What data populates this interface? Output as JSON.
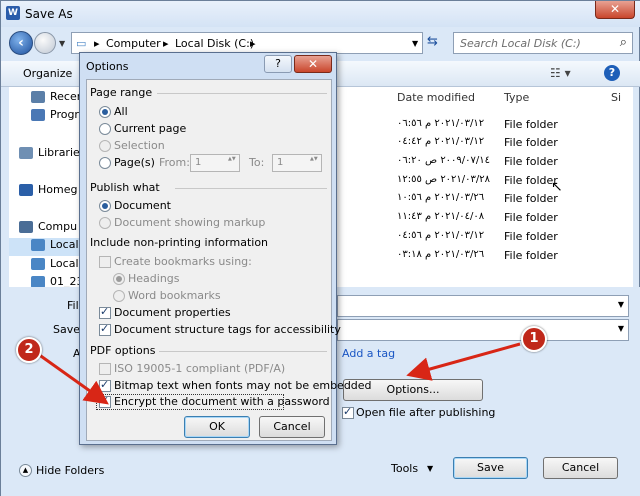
{
  "window": {
    "title": "Save As",
    "app_icon": "W",
    "close": "✕"
  },
  "nav": {
    "back_icon": "back-arrow-icon",
    "breadcrumb": [
      "Computer",
      "Local Disk (C:)"
    ],
    "sep": "▸",
    "search_placeholder": "Search Local Disk (C:)"
  },
  "toolbar": {
    "organize": "Organize",
    "help": "?"
  },
  "sidebar": {
    "items": [
      {
        "label": "Recen",
        "color": "#5b7fa8"
      },
      {
        "label": "Progr",
        "color": "#4a78b5"
      },
      {
        "label": "Librarie",
        "color": "#6f8fb3"
      },
      {
        "label": "Homeg",
        "color": "#2b5fa8"
      },
      {
        "label": "Compu",
        "color": "#4a6d96"
      },
      {
        "label": "Local",
        "color": "#4a86c5"
      },
      {
        "label": "Local",
        "color": "#4a86c5"
      },
      {
        "label": "01_23",
        "color": "#4a86c5"
      }
    ]
  },
  "filelist": {
    "headers": {
      "date": "Date modified",
      "type": "Type",
      "size": "Si"
    },
    "rows": [
      {
        "date": "٢٠٢١/٠٣/١٢ م ٠٦:٥٦",
        "type": "File folder"
      },
      {
        "date": "٢٠٢١/٠٣/١٢ م ٠٤:٤٢",
        "type": "File folder"
      },
      {
        "date": "٢٠٠٩/٠٧/١٤ ص ٠٦:٢٠",
        "type": "File folder"
      },
      {
        "date": "٢٠٢١/٠٣/٢٨ ص ١٢:٥٥",
        "type": "File folder"
      },
      {
        "date": "٢٠٢١/٠٣/٢٦ م ١٠:٥٦",
        "type": "File folder"
      },
      {
        "date": "٢٠٢١/٠٤/٠٨ م ١١:٤٣",
        "type": "File folder"
      },
      {
        "date": "٢٠٢١/٠٣/١٢ م ٠٤:٥٦",
        "type": "File folder"
      },
      {
        "date": "٢٠٢١/٠٣/٢٦ م ٠٣:١٨",
        "type": "File folder"
      }
    ]
  },
  "save_form": {
    "filename_label": "Fil",
    "savetype_label": "Save",
    "authors_label": "A",
    "add_tag": "Add a tag",
    "options_button": "Options...",
    "open_after_label": "Open file after publishing"
  },
  "footer": {
    "hide_folders": "Hide Folders",
    "tools": "Tools",
    "save": "Save",
    "cancel": "Cancel"
  },
  "options_dialog": {
    "title": "Options",
    "help": "?",
    "close": "✕",
    "page_range": {
      "heading": "Page range",
      "all": "All",
      "current_page": "Current page",
      "selection": "Selection",
      "pages": "Page(s)",
      "from_label": "From:",
      "from_value": "1",
      "to_label": "To:",
      "to_value": "1"
    },
    "publish_what": {
      "heading": "Publish what",
      "document": "Document",
      "markup": "Document showing markup"
    },
    "non_printing": {
      "heading": "Include non-printing information",
      "create_bookmarks": "Create bookmarks using:",
      "headings": "Headings",
      "word_bookmarks": "Word bookmarks",
      "doc_properties": "Document properties",
      "structure_tags": "Document structure tags for accessibility"
    },
    "pdf_options": {
      "heading": "PDF options",
      "iso": "ISO 19005-1 compliant (PDF/A)",
      "bitmap": "Bitmap text when fonts may not be embedded",
      "encrypt": "Encrypt the document with a password"
    },
    "ok": "OK",
    "cancel": "Cancel"
  },
  "annotations": {
    "marker1": "1",
    "marker2": "2",
    "color": "#d82616"
  }
}
